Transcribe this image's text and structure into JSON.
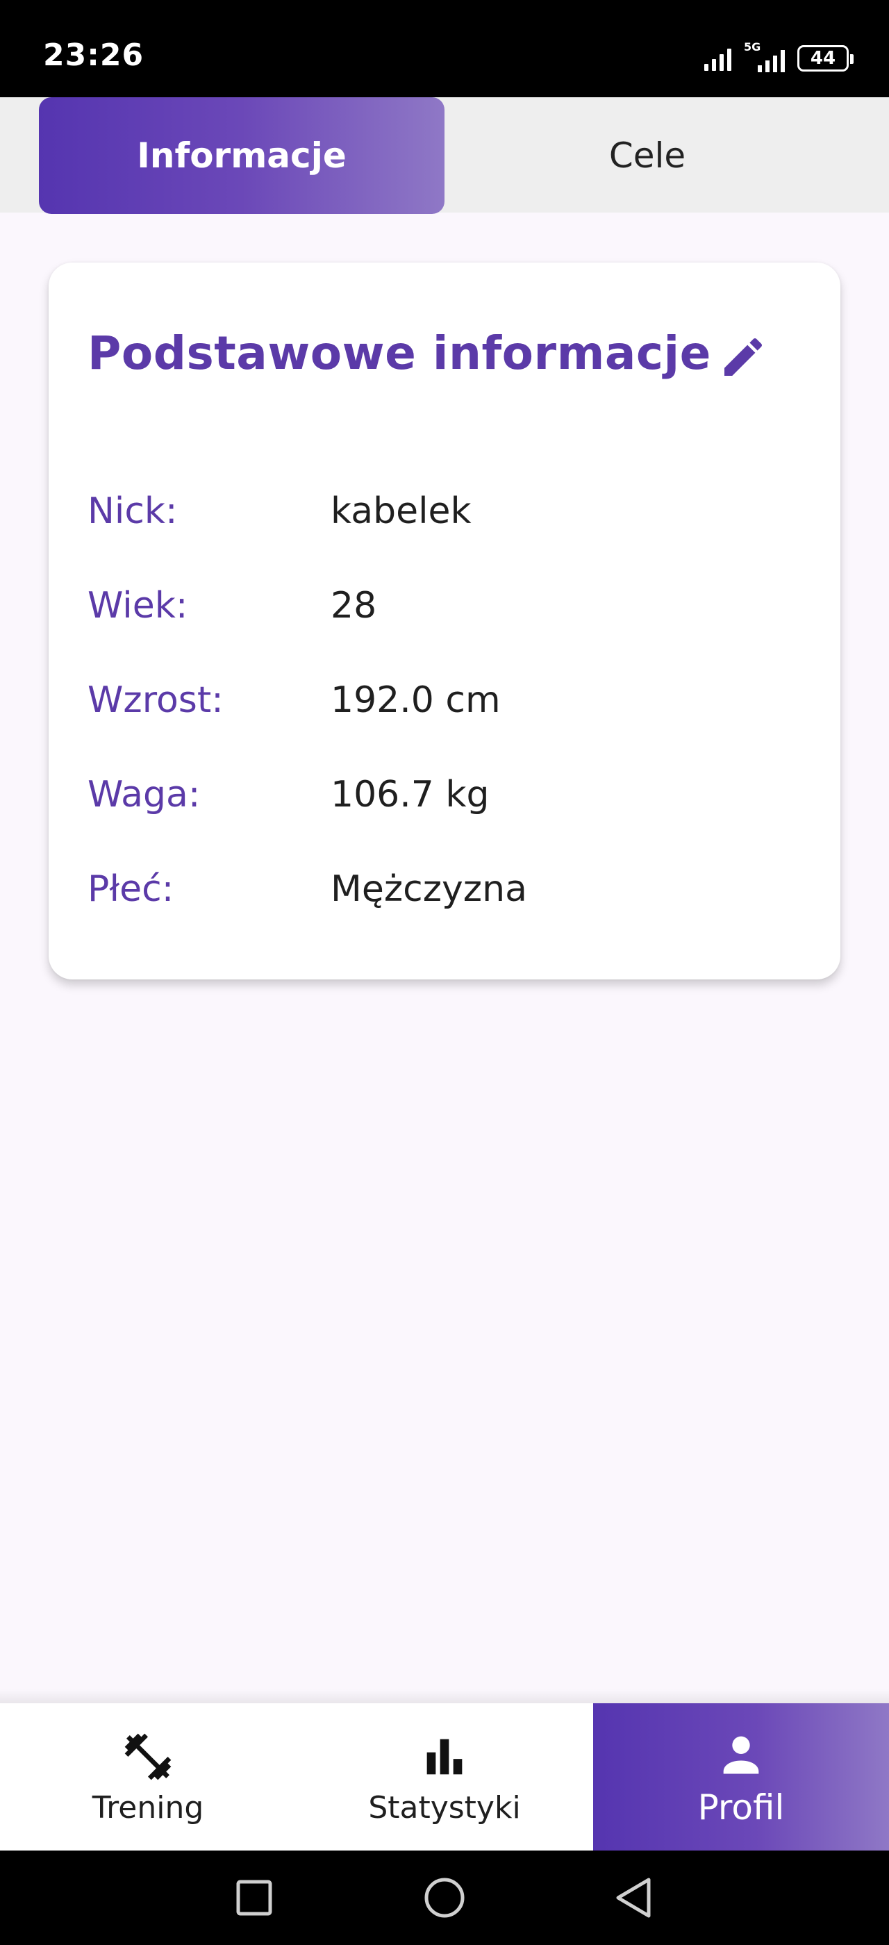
{
  "status_bar": {
    "time": "23:26",
    "network_label": "5G",
    "battery_level": "44"
  },
  "tabs": {
    "active_label": "Informacje",
    "inactive_label": "Cele"
  },
  "card": {
    "title": "Podstawowe informacje",
    "edit_icon": "pencil-icon",
    "rows": [
      {
        "label": "Nick:",
        "value": "kabelek"
      },
      {
        "label": "Wiek:",
        "value": "28"
      },
      {
        "label": "Wzrost:",
        "value": "192.0 cm"
      },
      {
        "label": "Waga:",
        "value": "106.7 kg"
      },
      {
        "label": "Płeć:",
        "value": "Mężczyzna"
      }
    ]
  },
  "bottom_nav": {
    "items": [
      {
        "label": "Trening",
        "icon": "dumbbell-icon"
      },
      {
        "label": "Statystyki",
        "icon": "bar-chart-icon"
      },
      {
        "label": "Profil",
        "icon": "person-icon"
      }
    ],
    "selected": "Profil"
  },
  "colors": {
    "accent": "#5b3aa8",
    "gradient_start": "#5535b0",
    "gradient_end": "#8f78c6",
    "background": "#fbf7fd"
  }
}
